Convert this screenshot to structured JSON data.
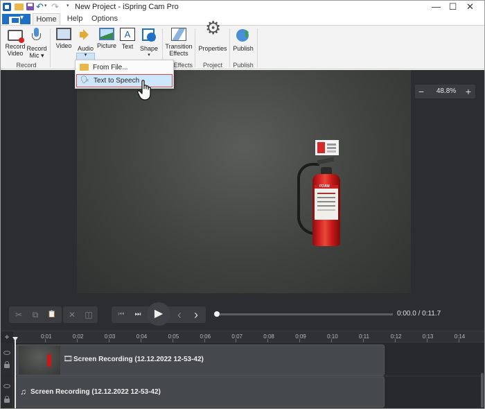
{
  "window": {
    "title": "New Project - iSpring Cam Pro",
    "controls": {
      "minimize": "—",
      "maximize": "☐",
      "close": "✕"
    }
  },
  "quick_access": {
    "undo_icon": "↶",
    "redo_icon": "↷",
    "dropdown": "▾"
  },
  "tabs": {
    "home": "Home",
    "help": "Help",
    "options": "Options"
  },
  "ribbon": {
    "record_video": "Record Video",
    "record_mic": "Record Mic ▾",
    "video": "Video",
    "audio": "Audio",
    "audio_arrow": "▾",
    "picture": "Picture",
    "text": "Text",
    "text_glyph": "A",
    "shape": "Shape",
    "shape_arrow": "▾",
    "transition_effects": "Transition Effects",
    "properties": "Properties",
    "publish": "Publish",
    "groups": {
      "record": "Record",
      "effects": "Effects",
      "project": "Project",
      "publish": "Publish"
    }
  },
  "audio_menu": {
    "items": [
      {
        "label": "From File...",
        "icon": "folder-open-icon"
      },
      {
        "label": "Text to Speech",
        "icon": "text-to-speech-icon"
      }
    ]
  },
  "canvas": {
    "zoom": "48.8%",
    "zoom_out": "−",
    "zoom_in": "+",
    "preview_sign_text": "",
    "extinguisher_label": "FOAM"
  },
  "player": {
    "cut": "✂",
    "copy": "⧉",
    "paste": "📋",
    "delete": "✕",
    "split": "◫",
    "prev": "⏮",
    "next_frame": "⏭",
    "play": "▶",
    "back": "‹",
    "forward": "›",
    "time": "0:00.0 / 0:11.7",
    "progress": 0.0
  },
  "timeline": {
    "add": "+",
    "ticks": [
      "0:01",
      "0:02",
      "0:03",
      "0:04",
      "0:05",
      "0:06",
      "0:07",
      "0:08",
      "0:09",
      "0:10",
      "0:11",
      "0:12",
      "0:13",
      "0:14"
    ],
    "tracks": [
      {
        "type": "video",
        "icon": "🎞",
        "title": "Screen Recording (12.12.2022 12-53-42)"
      },
      {
        "type": "audio",
        "icon": "♫",
        "title": "Screen Recording (12.12.2022 12-53-42)"
      }
    ]
  },
  "colors": {
    "accent": "#1f6fc4",
    "menu_highlight": "#cde6fa",
    "menu_outline": "#d04a4a",
    "editor_bg": "#2b2d30"
  }
}
